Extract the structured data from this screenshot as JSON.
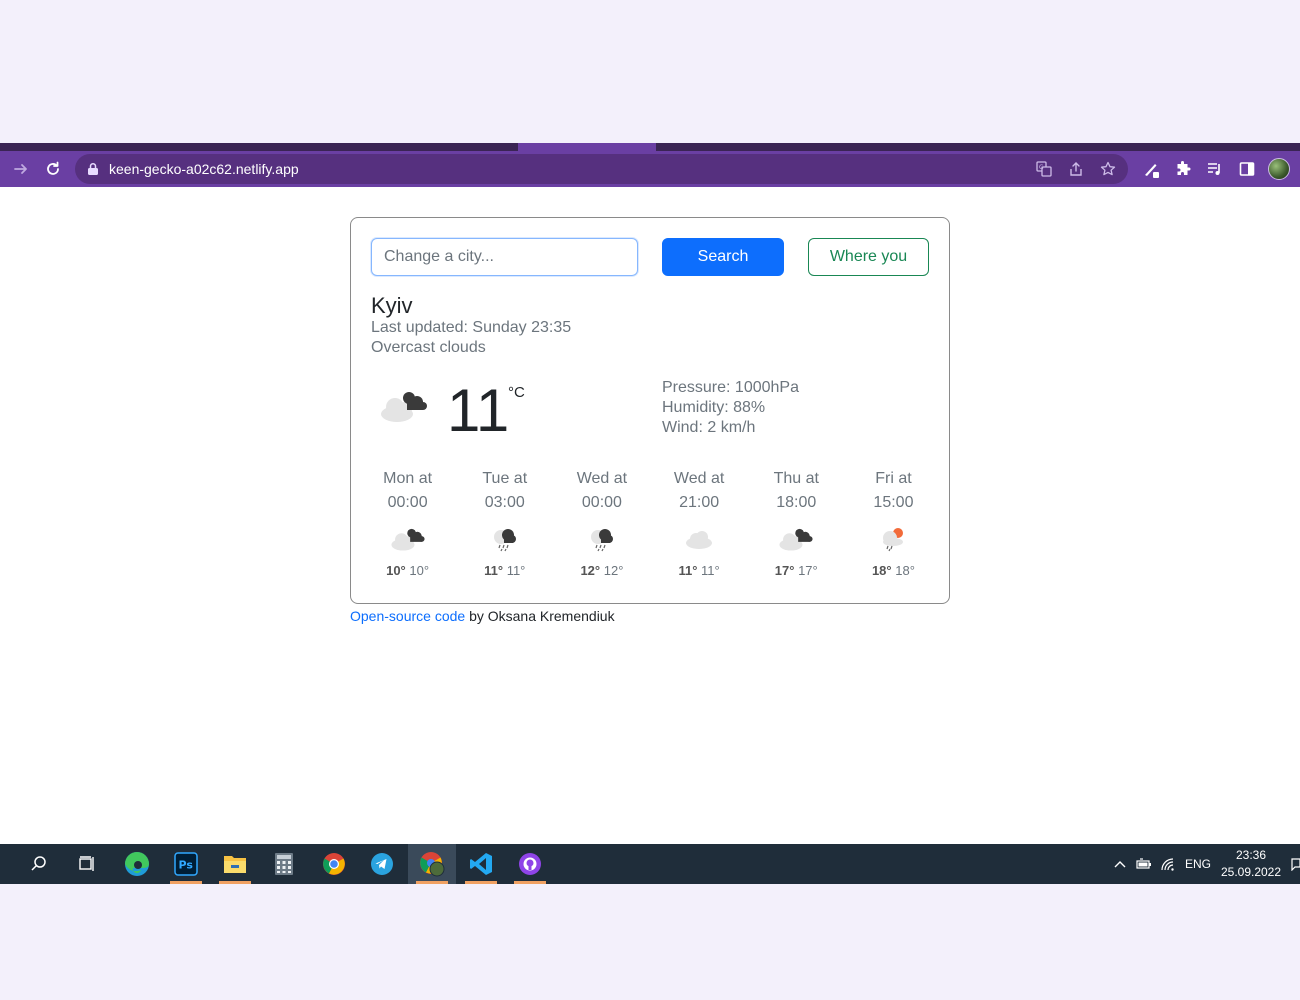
{
  "browser": {
    "url_host": "keen-gecko-a02c62.netlify.app",
    "accent_color": "#6a3fa3"
  },
  "weather": {
    "search_placeholder": "Change a city...",
    "search_button": "Search",
    "location_button": "Where you",
    "city": "Kyiv",
    "last_updated": "Last updated: Sunday 23:35",
    "description": "Overcast clouds",
    "temperature": "11",
    "unit": "°C",
    "pressure": "Pressure: 1000hPa",
    "humidity": "Humidity: 88%",
    "wind": "Wind: 2 km/h",
    "main_icon": "broken-clouds-icon",
    "forecast": [
      {
        "day": "Mon at",
        "time": "00:00",
        "icon": "broken-clouds-icon",
        "max": "10°",
        "min": "10°"
      },
      {
        "day": "Tue at",
        "time": "03:00",
        "icon": "rain-cloud-icon",
        "max": "11°",
        "min": "11°"
      },
      {
        "day": "Wed at",
        "time": "00:00",
        "icon": "rain-cloud-icon",
        "max": "12°",
        "min": "12°"
      },
      {
        "day": "Wed at",
        "time": "21:00",
        "icon": "cloud-icon",
        "max": "11°",
        "min": "11°"
      },
      {
        "day": "Thu at",
        "time": "18:00",
        "icon": "broken-clouds-icon",
        "max": "17°",
        "min": "17°"
      },
      {
        "day": "Fri at",
        "time": "15:00",
        "icon": "sun-rain-icon",
        "max": "18°",
        "min": "18°"
      }
    ]
  },
  "footer": {
    "link_text": "Open-source code",
    "rest_text": " by Oksana Kremendiuk"
  },
  "taskbar": {
    "apps": [
      "search-icon",
      "task-view-icon",
      "edge-icon",
      "photoshop-icon",
      "file-explorer-icon",
      "calculator-icon",
      "chrome-icon",
      "telegram-icon",
      "chrome-profile-icon",
      "vscode-icon",
      "github-desktop-icon"
    ],
    "photoshop_label": "Ps",
    "language": "ENG",
    "time": "23:36",
    "date": "25.09.2022"
  }
}
